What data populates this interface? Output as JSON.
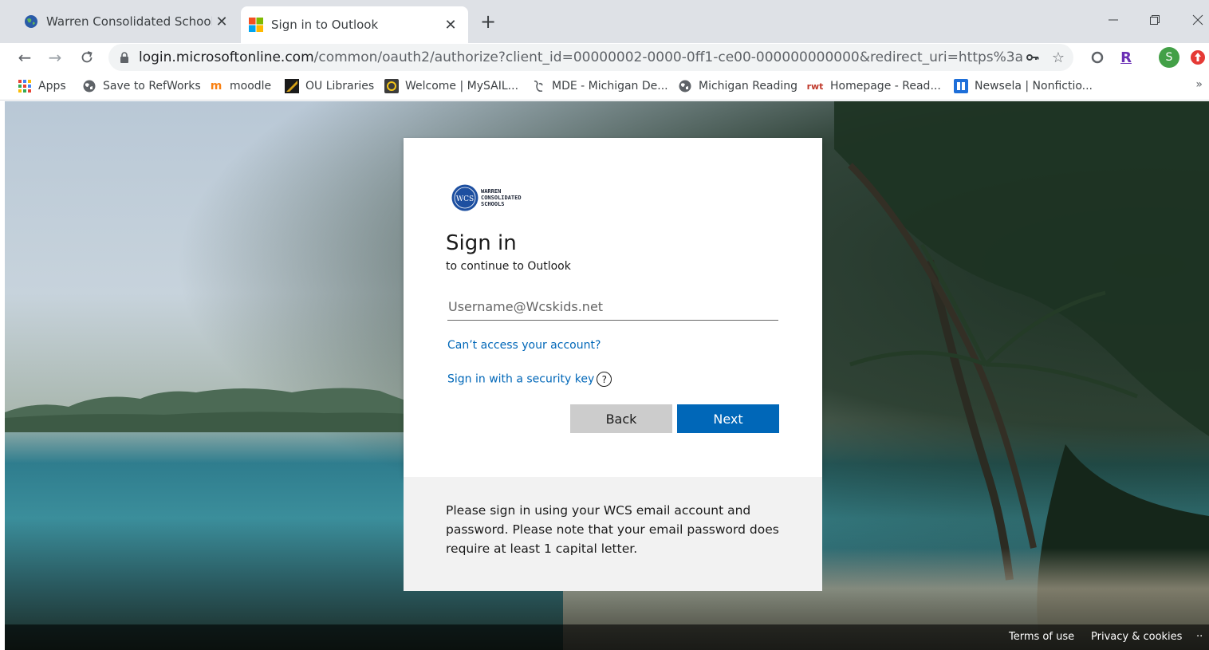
{
  "browser": {
    "tabs": [
      {
        "title": "Warren Consolidated Schools",
        "active": false
      },
      {
        "title": "Sign in to Outlook",
        "active": true
      }
    ],
    "url_host": "login.microsoftonline.com",
    "url_rest": "/common/oauth2/authorize?client_id=00000002-0000-0ff1-ce00-000000000000&redirect_uri=https%3a%2f%2foutlook....",
    "profile_initial": "S",
    "extension_letter": "R",
    "bookmarks": [
      {
        "label": "Apps",
        "icon": "apps-grid-icon"
      },
      {
        "label": "Save to RefWorks",
        "icon": "globe-icon"
      },
      {
        "label": "moodle",
        "icon": "moodle-icon"
      },
      {
        "label": "OU Libraries",
        "icon": "ou-libraries-icon"
      },
      {
        "label": "Welcome | MySAIL...",
        "icon": "mysail-icon"
      },
      {
        "label": "MDE - Michigan De...",
        "icon": "mde-icon"
      },
      {
        "label": "Michigan Reading",
        "icon": "globe-icon"
      },
      {
        "label": "Homepage - Read...",
        "icon": "rwt-icon"
      },
      {
        "label": "Newsela | Nonfictio...",
        "icon": "newsela-icon"
      }
    ],
    "bookmark_icon_text": {
      "rwt": "rwt"
    },
    "more_label": "»"
  },
  "signin": {
    "logo_lines": [
      "WARREN",
      "CONSOLIDATED",
      "SCHOOLS"
    ],
    "logo_seal_letters": "WCS",
    "title": "Sign in",
    "subtitle": "to continue to Outlook",
    "username_placeholder": "Username@Wcskids.net",
    "cant_access_link": "Can’t access your account?",
    "security_key_link": "Sign in with a security key",
    "help_glyph": "?",
    "back_label": "Back",
    "next_label": "Next",
    "note": "Please sign in using your WCS email account and password. Please note that your email password does require at least 1 capital letter."
  },
  "footer": {
    "terms": "Terms of use",
    "privacy": "Privacy & cookies",
    "more": "··"
  },
  "colors": {
    "accent": "#0067b8",
    "back_button": "#cccccc",
    "note_bg": "#f2f2f2"
  }
}
